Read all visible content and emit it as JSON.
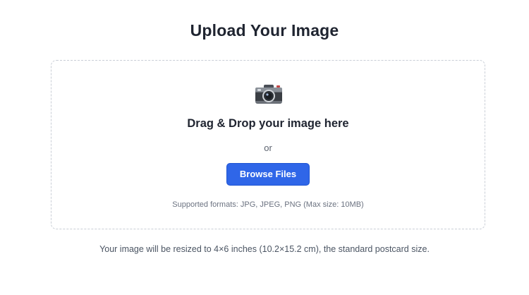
{
  "header": {
    "title": "Upload Your Image"
  },
  "dropzone": {
    "icon": "camera-icon",
    "heading": "Drag & Drop your image here",
    "separator": "or",
    "browse_label": "Browse Files",
    "formats": "Supported formats: JPG, JPEG, PNG (Max size: 10MB)"
  },
  "footer": {
    "note": "Your image will be resized to 4×6 inches (10.2×15.2 cm), the standard postcard size."
  },
  "colors": {
    "accent": "#2f66e8",
    "border": "#c9ced6",
    "text": "#1f2430",
    "muted": "#6b7280"
  }
}
